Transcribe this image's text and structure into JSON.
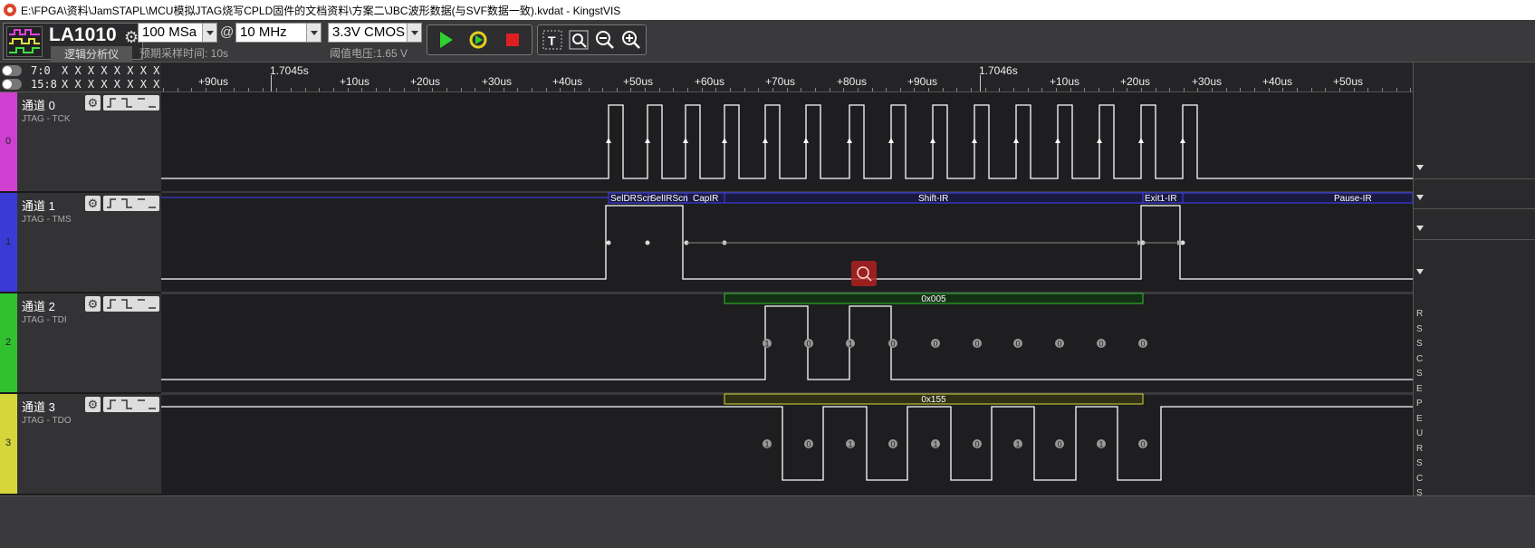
{
  "window": {
    "title": "E:\\FPGA\\资料\\JamSTAPL\\MCU模拟JTAG烧写CPLD固件的文档资料\\方案二\\JBC波形数据(与SVF数据一致).kvdat - KingstVIS"
  },
  "device": {
    "name": "LA1010",
    "subtitle": "逻辑分析仪"
  },
  "sampling": {
    "rate": "100 MSa",
    "at": "@",
    "freq": "10 MHz",
    "est_time": "预期采样时间: 10s",
    "voltage": "3.3V CMOS",
    "threshold": "阈值电压:1.65 V"
  },
  "channel_groups": [
    {
      "label": "7:0",
      "bits": "X X X X X X X X"
    },
    {
      "label": "15:8",
      "bits": "X X X X X X X X"
    }
  ],
  "ruler": {
    "major": [
      "1.7045s",
      "1.7046s"
    ],
    "ticks": [
      "+90us",
      "+10us",
      "+20us",
      "+30us",
      "+40us",
      "+50us",
      "+60us",
      "+70us",
      "+80us",
      "+90us",
      "+10us",
      "+20us",
      "+30us",
      "+40us",
      "+50us"
    ]
  },
  "channels": [
    {
      "index": "0",
      "name": "通道 0",
      "alias": "JTAG - TCK",
      "color": "#d63fd6"
    },
    {
      "index": "1",
      "name": "通道 1",
      "alias": "JTAG - TMS",
      "color": "#4040d8"
    },
    {
      "index": "2",
      "name": "通道 2",
      "alias": "JTAG - TDI",
      "color": "#2fbf2f"
    },
    {
      "index": "3",
      "name": "通道 3",
      "alias": "JTAG - TDO",
      "color": "#d6d63a"
    }
  ],
  "decode": {
    "tms_states": [
      "SelDRScn",
      "SelIRScn",
      "CapIR",
      "Shift-IR",
      "Exit1-IR",
      "Pause-IR"
    ],
    "tdi_value": "0x005",
    "tdo_value": "0x155",
    "tdi_bits": [
      "1",
      "0",
      "1",
      "0",
      "0",
      "0",
      "0",
      "0",
      "0",
      "0"
    ],
    "tdo_bits": [
      "1",
      "0",
      "1",
      "0",
      "1",
      "0",
      "1",
      "0",
      "1",
      "0"
    ]
  },
  "right_panel": {
    "labels": [
      "R",
      "S",
      "S",
      "C",
      "S",
      "E",
      "P",
      "E",
      "U",
      "R",
      "S",
      "C",
      "S"
    ]
  }
}
